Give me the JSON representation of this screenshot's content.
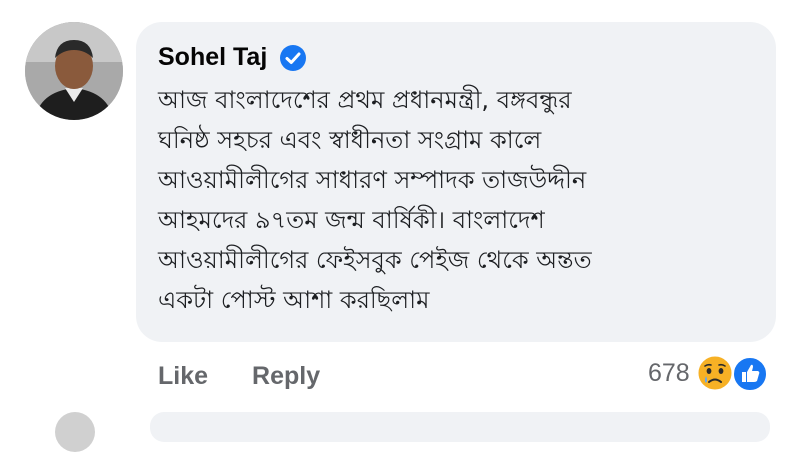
{
  "comment": {
    "author": "Sohel Taj",
    "verified_icon": "verified-badge-icon",
    "text_lines": [
      "আজ বাংলাদেশের প্রথম প্রধানমন্ত্রী, বঙ্গবন্ধুর",
      "ঘনিষ্ঠ সহচর এবং স্বাধীনতা সংগ্রাম কালে",
      "আওয়ামীলীগের সাধারণ সম্পাদক তাজউদ্দীন",
      "আহমদের ৯৭তম জন্ম বার্ষিকী। বাংলাদেশ",
      "আওয়ামীলীগের ফেইসবুক পেইজ থেকে অন্তত",
      "একটা পোস্ট আশা করছিলাম"
    ]
  },
  "actions": {
    "like_label": "Like",
    "reply_label": "Reply"
  },
  "reactions": {
    "count": "678",
    "icons": [
      "sad-reaction-icon",
      "like-reaction-icon"
    ]
  },
  "colors": {
    "bubble": "#f0f2f5",
    "verified": "#1877f2",
    "like": "#1877f2",
    "sad": "#f7b125",
    "meta_text": "#65676b"
  }
}
